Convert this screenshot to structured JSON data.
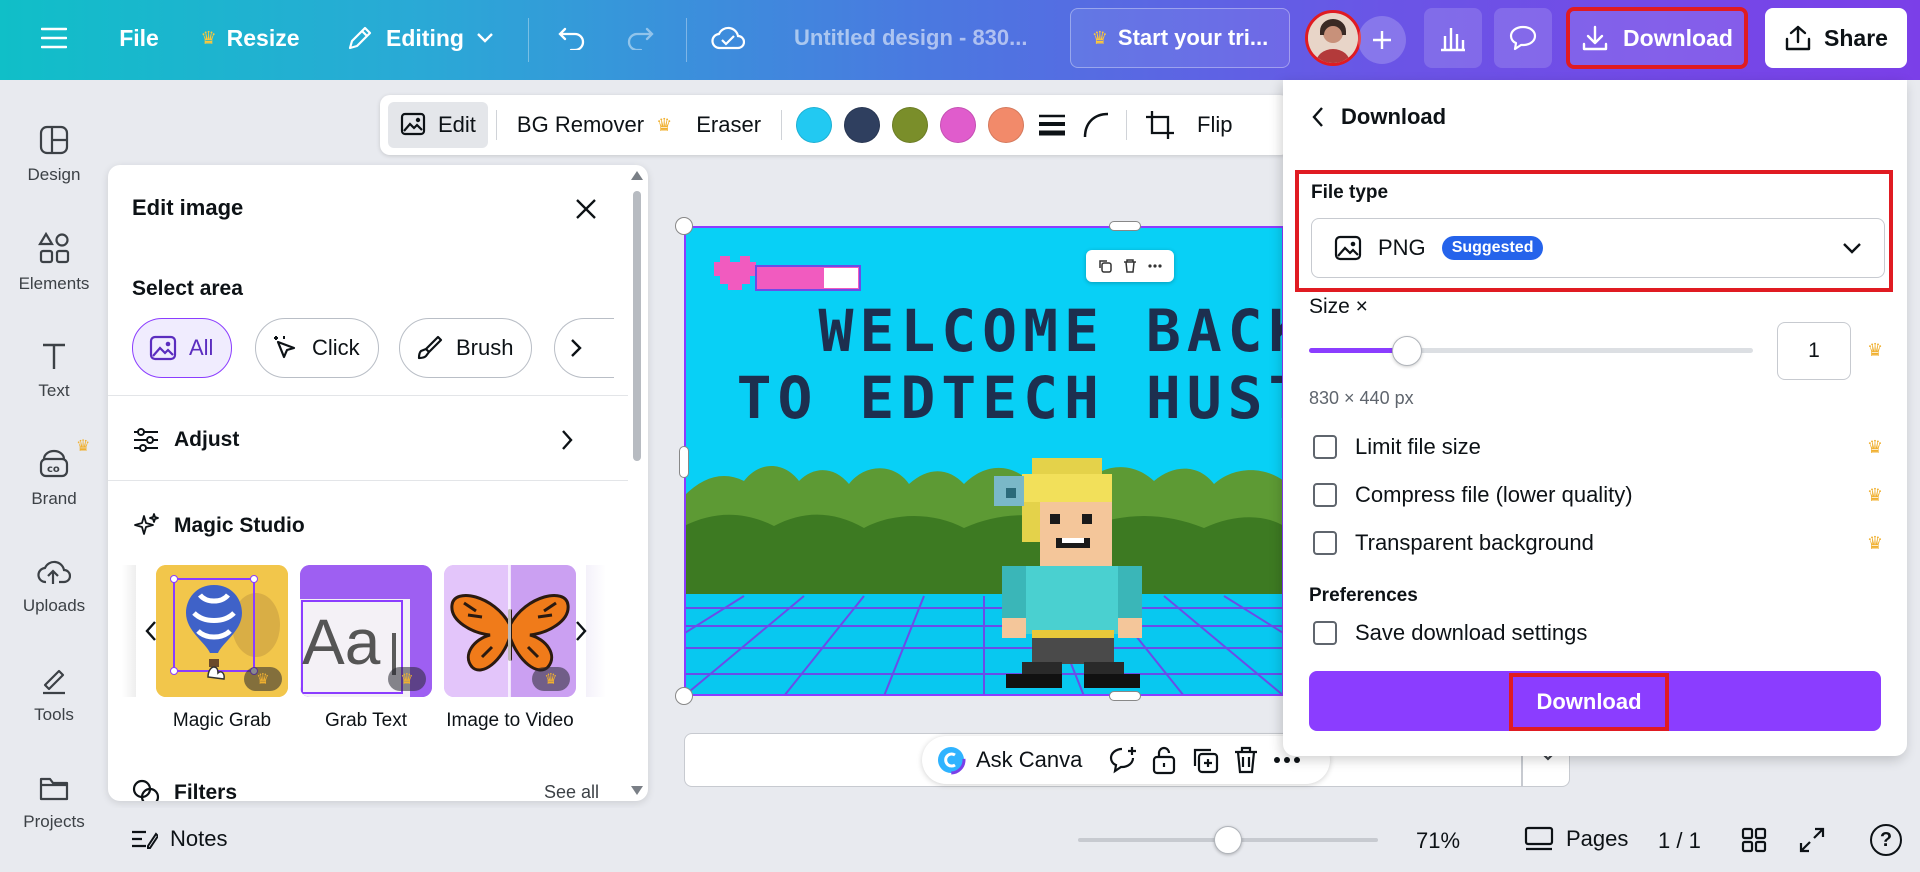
{
  "topbar": {
    "file_label": "File",
    "resize_label": "Resize",
    "editing_label": "Editing",
    "design_title": "Untitled design - 830...",
    "trial_label": "Start your tri...",
    "download_label": "Download",
    "share_label": "Share"
  },
  "sidebar": {
    "items": [
      {
        "label": "Design"
      },
      {
        "label": "Elements"
      },
      {
        "label": "Text"
      },
      {
        "label": "Brand"
      },
      {
        "label": "Uploads"
      },
      {
        "label": "Tools"
      },
      {
        "label": "Projects"
      }
    ]
  },
  "toolbar": {
    "edit_label": "Edit",
    "bg_remover_label": "BG Remover",
    "eraser_label": "Eraser",
    "flip_label": "Flip",
    "swatches": [
      "#22c9f2",
      "#2f3f5f",
      "#7a8e2a",
      "#e05ccc",
      "#f28a6a"
    ]
  },
  "edit_panel": {
    "title": "Edit image",
    "select_area_label": "Select area",
    "chips": [
      {
        "label": "All"
      },
      {
        "label": "Click"
      },
      {
        "label": "Brush"
      }
    ],
    "adjust_label": "Adjust",
    "magic_studio_label": "Magic Studio",
    "cards": [
      {
        "label": "Magic Grab"
      },
      {
        "label": "Grab Text"
      },
      {
        "label": "Image to Video"
      }
    ],
    "grab_text_sample": "Aa",
    "filters_label": "Filters",
    "see_all_label": "See all"
  },
  "canvas": {
    "headline_line1": "WELCOME BACK",
    "headline_line2": "TO EDTECH HUSTLE"
  },
  "ask_bar": {
    "ask_label": "Ask Canva"
  },
  "download_panel": {
    "title": "Download",
    "file_type_label": "File type",
    "file_type_value": "PNG",
    "suggested_badge": "Suggested",
    "size_label": "Size ×",
    "size_value": "1",
    "size_slider_fraction": 0.22,
    "dimensions": "830 × 440 px",
    "options": [
      {
        "label": "Limit file size"
      },
      {
        "label": "Compress file (lower quality)"
      },
      {
        "label": "Transparent background"
      }
    ],
    "preferences_label": "Preferences",
    "save_settings_label": "Save download settings",
    "download_button_label": "Download"
  },
  "bottom": {
    "notes_label": "Notes",
    "zoom_value": "71%",
    "zoom_fraction": 0.5,
    "pages_label": "Pages",
    "page_count": "1 / 1"
  },
  "colors": {
    "accent": "#8b3dff",
    "highlight": "#e01b22",
    "suggested_badge": "#2563eb"
  }
}
